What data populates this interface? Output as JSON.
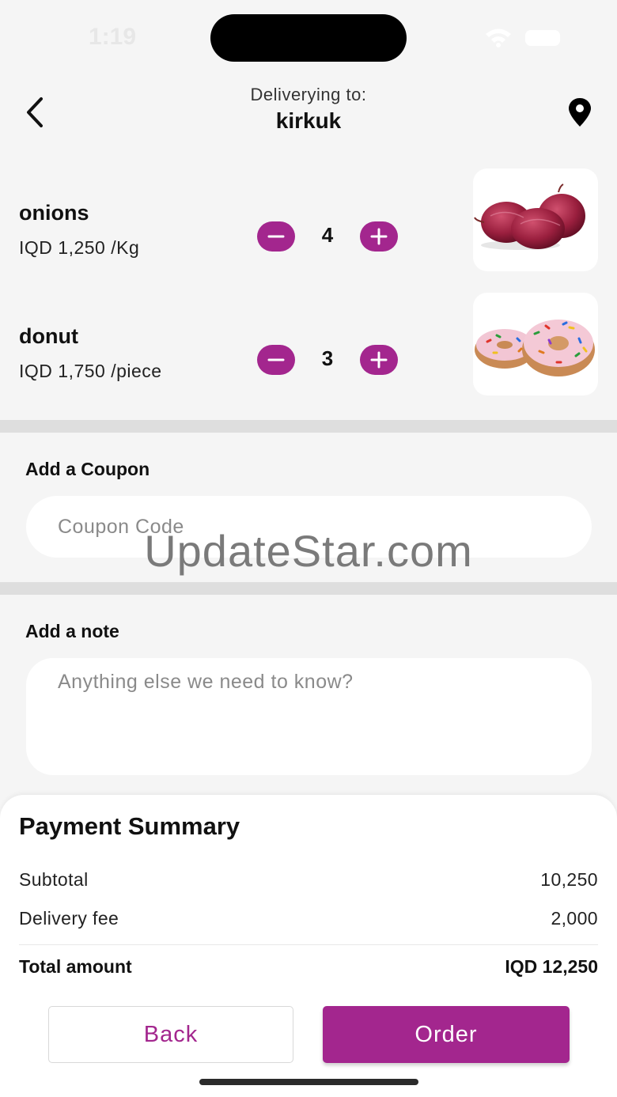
{
  "status_bar": {
    "time": "1:19"
  },
  "header": {
    "deliver_label": "Deliverying to:",
    "city": "kirkuk"
  },
  "cart": {
    "items": [
      {
        "name": "onions",
        "price": "IQD 1,250 /Kg",
        "quantity": "4",
        "image": "onions-image"
      },
      {
        "name": "donut",
        "price": "IQD 1,750 /piece",
        "quantity": "3",
        "image": "donut-image"
      }
    ]
  },
  "coupon": {
    "title": "Add a Coupon",
    "placeholder": "Coupon Code"
  },
  "note": {
    "title": "Add a note",
    "placeholder": "Anything else we need to know?"
  },
  "watermark": "UpdateStar.com",
  "summary": {
    "title": "Payment Summary",
    "subtotal_label": "Subtotal",
    "subtotal_value": "10,250",
    "delivery_label": "Delivery fee",
    "delivery_value": "2,000",
    "total_label": "Total amount",
    "total_value": "IQD 12,250"
  },
  "actions": {
    "back_label": "Back",
    "order_label": "Order"
  },
  "colors": {
    "accent": "#a3268e",
    "background": "#f5f5f5",
    "divider": "#dedede"
  }
}
